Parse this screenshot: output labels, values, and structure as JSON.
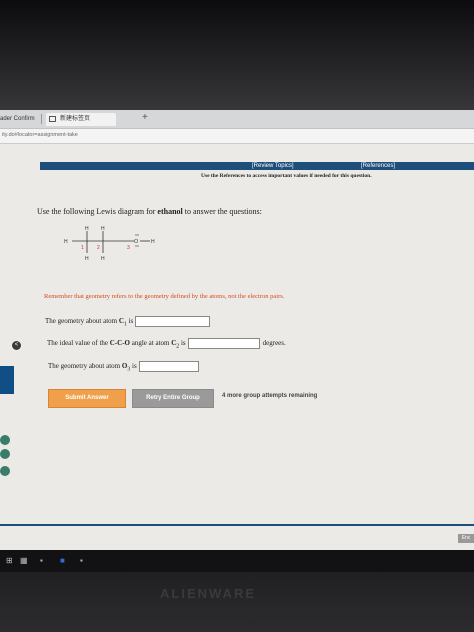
{
  "browser": {
    "tabs": [
      {
        "label": "ader Confirm"
      },
      {
        "label": "新建标签页"
      }
    ],
    "new_tab_symbol": "+",
    "url": "ity.do#locator=assignment-take"
  },
  "toolbar": {
    "review_topics": "[Review Topics]",
    "references": "[References]",
    "reference_note": "Use the References to access important values if needed for this question."
  },
  "question": {
    "prefix": "Use the following Lewis diagram for ",
    "compound": "ethanol",
    "suffix": " to answer the questions:"
  },
  "lewis": {
    "top_h1": "H",
    "top_h2": "H",
    "left_h": "H",
    "right_h": "H",
    "bottom_h1": "H",
    "bottom_h2": "H",
    "label_1": "1",
    "label_2": "2",
    "label_3": "3",
    "oxygen": "O"
  },
  "hint": "Remember that geometry refers to the geometry defined by the atoms, not the electron pairs.",
  "items": [
    {
      "prefix": "The geometry about atom ",
      "atom": "C",
      "sub": "1",
      "suffix": " is"
    },
    {
      "prefix": "The ideal value of the ",
      "bold": "C-C-O",
      "middle": " angle at atom ",
      "atom": "C",
      "sub": "2",
      "suffix": " is",
      "unit": "degrees."
    },
    {
      "prefix": "The geometry about atom ",
      "atom": "O",
      "sub": "3",
      "suffix": " is"
    }
  ],
  "buttons": {
    "submit": "Submit Answer",
    "retry": "Retry Entire Group",
    "attempts": "4 more group attempts remaining"
  },
  "nav": {
    "left_arrow": "<",
    "end": "Enc"
  },
  "brand": "ALIENWARE",
  "colors": {
    "accent_blue": "#1e4f7a",
    "hint_red": "#d64a1d",
    "submit_orange": "#f0a04a"
  }
}
